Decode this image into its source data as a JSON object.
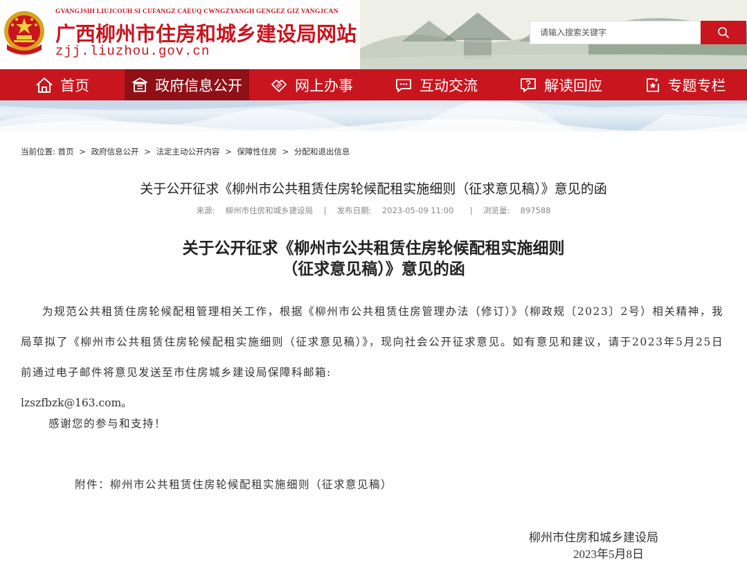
{
  "header": {
    "pinyin": "GVANGJSIH LIUJCOUH SI CUFANGZ CAEUQ CWNGZYANGH GENGEZ GIZ VANGJCAN",
    "site_name": "广西柳州市住房和城乡建设局网站",
    "domain": "zjj.liuzhou.gov.cn",
    "brand_color": "#c9151e"
  },
  "search": {
    "placeholder": "请输入搜索关键字",
    "button_icon": "search-icon"
  },
  "nav": {
    "items": [
      {
        "label": "首页",
        "icon": "home-icon",
        "active": false
      },
      {
        "label": "政府信息公开",
        "icon": "building-icon",
        "active": true
      },
      {
        "label": "网上办事",
        "icon": "handshake-icon",
        "active": false
      },
      {
        "label": "互动交流",
        "icon": "chat-icon",
        "active": false
      },
      {
        "label": "解读回应",
        "icon": "question-icon",
        "active": false
      },
      {
        "label": "专题专栏",
        "icon": "star-doc-icon",
        "active": false
      }
    ]
  },
  "breadcrumb": {
    "prefix": "当前位置:",
    "items": [
      "首页",
      "政府信息公开",
      "法定主动公开内容",
      "保障性住房",
      "分配和退出信息"
    ],
    "separator": ">"
  },
  "article": {
    "title": "关于公开征求《柳州市公共租赁住房轮候配租实施细则（征求意见稿）》意见的函",
    "source_label": "来源:",
    "source": "柳州市住房和城乡建设局",
    "date_label": "发布日期:",
    "date": "2023-05-09 11:00",
    "views_label": "浏览量:",
    "views": "897588",
    "meta_divider": "|"
  },
  "document": {
    "title_line1": "关于公开征求《柳州市公共租赁住房轮候配租实施细则",
    "title_line2": "（征求意见稿）》意见的函",
    "paragraph": "为规范公共租赁住房轮候配租管理相关工作，根据《柳州市公共租赁住房管理办法（修订）》（柳政规〔2023〕2号）相关精神，我局草拟了《柳州市公共租赁住房轮候配租实施细则（征求意见稿）》，现向社会公开征求意见。如有意见和建议，请于2023年5月25日前通过电子邮件将意见发送至市住房城乡建设局保障科邮箱:",
    "email": "lzszfbzk@163.com。",
    "thanks": "感谢您的参与和支持！",
    "attachment": "附件：柳州市公共租赁住房轮候配租实施细则（征求意见稿）",
    "sign_org": "柳州市住房和城乡建设局",
    "sign_date": "2023年5月8日"
  }
}
